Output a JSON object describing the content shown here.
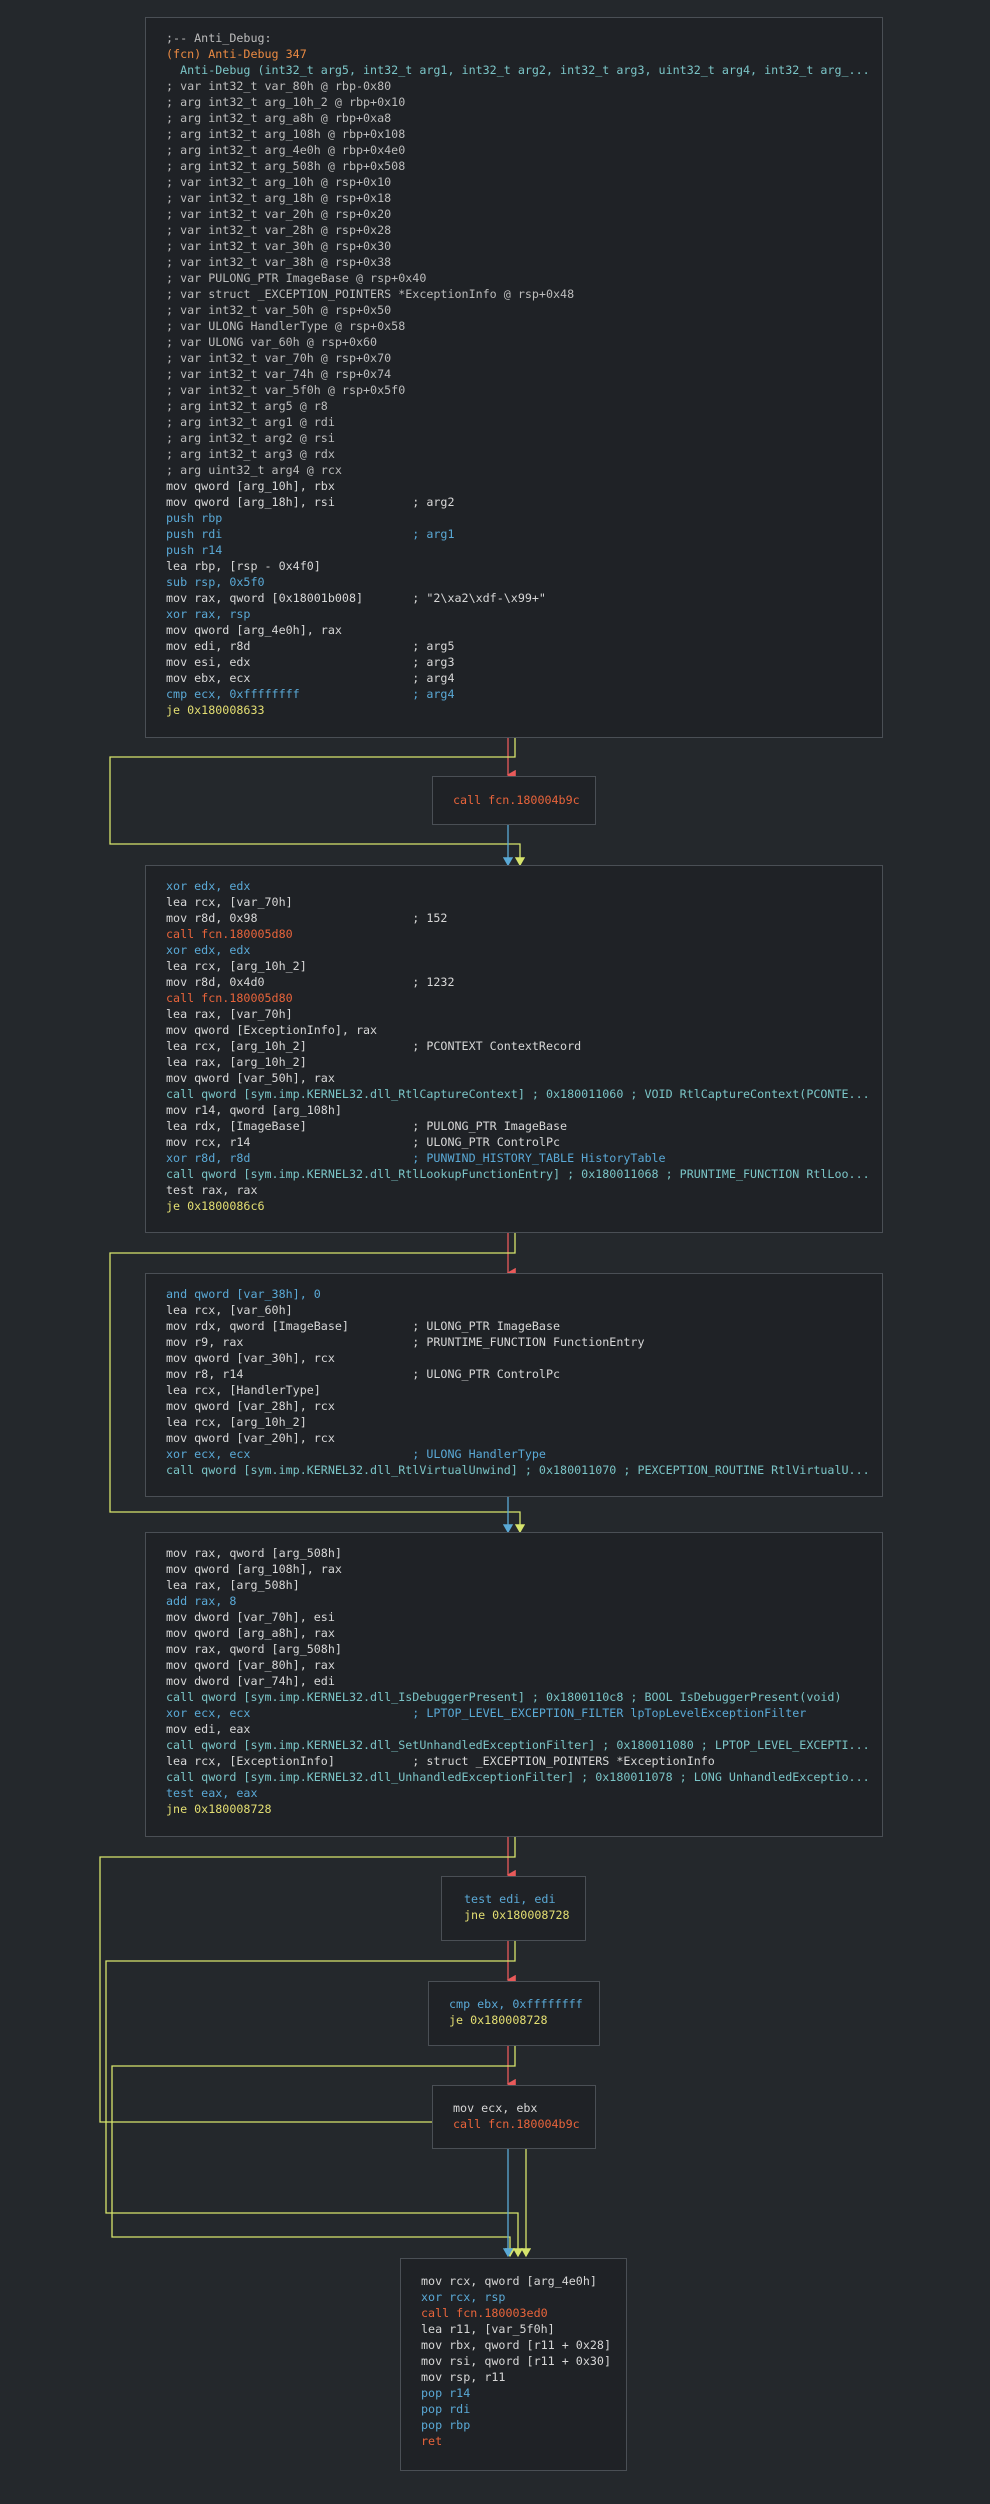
{
  "graph": {
    "function_name": "Anti_Debug",
    "colors": {
      "background": "#24282c",
      "node_background": "#1f2226",
      "node_border": "#4a4f55",
      "edge_true": "#d6e46c",
      "edge_false": "#e85a5a",
      "edge_unconditional": "#5aa9d6",
      "call_color": "#e8643b",
      "jump_color": "#e4df72",
      "flag_color": "#d07555",
      "symbol_color": "#7bc5c7"
    },
    "nodes": [
      {
        "id": "entry",
        "lines": [
          {
            "text": ";-- Anti_Debug:",
            "kind": "comment"
          },
          {
            "text": "(fcn) Anti-Debug 347",
            "kind": "fn"
          },
          {
            "text": "  Anti-Debug (int32_t arg5, int32_t arg1, int32_t arg2, int32_t arg3, uint32_t arg4, int32_t arg_...",
            "kind": "sym"
          },
          {
            "text": "; var int32_t var_80h @ rbp-0x80",
            "kind": "var"
          },
          {
            "text": "; arg int32_t arg_10h_2 @ rbp+0x10",
            "kind": "var"
          },
          {
            "text": "; arg int32_t arg_a8h @ rbp+0xa8",
            "kind": "var"
          },
          {
            "text": "; arg int32_t arg_108h @ rbp+0x108",
            "kind": "var"
          },
          {
            "text": "; arg int32_t arg_4e0h @ rbp+0x4e0",
            "kind": "var"
          },
          {
            "text": "; arg int32_t arg_508h @ rbp+0x508",
            "kind": "var"
          },
          {
            "text": "; var int32_t arg_10h @ rsp+0x10",
            "kind": "var"
          },
          {
            "text": "; var int32_t arg_18h @ rsp+0x18",
            "kind": "var"
          },
          {
            "text": "; var int32_t var_20h @ rsp+0x20",
            "kind": "var"
          },
          {
            "text": "; var int32_t var_28h @ rsp+0x28",
            "kind": "var"
          },
          {
            "text": "; var int32_t var_30h @ rsp+0x30",
            "kind": "var"
          },
          {
            "text": "; var int32_t var_38h @ rsp+0x38",
            "kind": "var"
          },
          {
            "text": "; var PULONG_PTR ImageBase @ rsp+0x40",
            "kind": "var"
          },
          {
            "text": "; var struct _EXCEPTION_POINTERS *ExceptionInfo @ rsp+0x48",
            "kind": "var"
          },
          {
            "text": "; var int32_t var_50h @ rsp+0x50",
            "kind": "var"
          },
          {
            "text": "; var ULONG HandlerType @ rsp+0x58",
            "kind": "var"
          },
          {
            "text": "; var ULONG var_60h @ rsp+0x60",
            "kind": "var"
          },
          {
            "text": "; var int32_t var_70h @ rsp+0x70",
            "kind": "var"
          },
          {
            "text": "; var int32_t var_74h @ rsp+0x74",
            "kind": "var"
          },
          {
            "text": "; var int32_t var_5f0h @ rsp+0x5f0",
            "kind": "var"
          },
          {
            "text": "; arg int32_t arg5 @ r8",
            "kind": "var"
          },
          {
            "text": "; arg int32_t arg1 @ rdi",
            "kind": "var"
          },
          {
            "text": "; arg int32_t arg2 @ rsi",
            "kind": "var"
          },
          {
            "text": "; arg int32_t arg3 @ rdx",
            "kind": "var"
          },
          {
            "text": "; arg uint32_t arg4 @ rcx",
            "kind": "var"
          },
          {
            "text": "mov qword [arg_10h], rbx",
            "kind": "mnem"
          },
          {
            "text": "mov qword [arg_18h], rsi           ; arg2",
            "kind": "mnem"
          },
          {
            "text": "push rbp",
            "kind": "nop"
          },
          {
            "text": "push rdi                           ; arg1",
            "kind": "nop"
          },
          {
            "text": "push r14",
            "kind": "nop"
          },
          {
            "text": "lea rbp, [rsp - 0x4f0]",
            "kind": "mnem"
          },
          {
            "text": "sub rsp, 0x5f0",
            "kind": "nop"
          },
          {
            "text": "mov rax, qword [0x18001b008]       ; \"2\\xa2\\xdf-\\x99+\"",
            "kind": "mnem"
          },
          {
            "text": "xor rax, rsp",
            "kind": "nop"
          },
          {
            "text": "mov qword [arg_4e0h], rax",
            "kind": "mnem"
          },
          {
            "text": "mov edi, r8d                       ; arg5",
            "kind": "mnem"
          },
          {
            "text": "mov esi, edx                       ; arg3",
            "kind": "mnem"
          },
          {
            "text": "mov ebx, ecx                       ; arg4",
            "kind": "mnem"
          },
          {
            "text": "cmp ecx, 0xffffffff                ; arg4",
            "kind": "nop"
          },
          {
            "text": "je 0x180008633",
            "kind": "jmp"
          }
        ]
      },
      {
        "id": "call_4b9c",
        "lines": [
          {
            "text": "call fcn.180004b9c",
            "kind": "call"
          }
        ]
      },
      {
        "id": "capture",
        "lines": [
          {
            "text": "xor edx, edx",
            "kind": "nop"
          },
          {
            "text": "lea rcx, [var_70h]",
            "kind": "mnem"
          },
          {
            "text": "mov r8d, 0x98                      ; 152",
            "kind": "mnem"
          },
          {
            "text": "call fcn.180005d80",
            "kind": "call"
          },
          {
            "text": "xor edx, edx",
            "kind": "nop"
          },
          {
            "text": "lea rcx, [arg_10h_2]",
            "kind": "mnem"
          },
          {
            "text": "mov r8d, 0x4d0                     ; 1232",
            "kind": "mnem"
          },
          {
            "text": "call fcn.180005d80",
            "kind": "call"
          },
          {
            "text": "lea rax, [var_70h]",
            "kind": "mnem"
          },
          {
            "text": "mov qword [ExceptionInfo], rax",
            "kind": "mnem"
          },
          {
            "text": "lea rcx, [arg_10h_2]               ; PCONTEXT ContextRecord",
            "kind": "mnem"
          },
          {
            "text": "lea rax, [arg_10h_2]",
            "kind": "mnem"
          },
          {
            "text": "mov qword [var_50h], rax",
            "kind": "mnem"
          },
          {
            "text": "call qword [sym.imp.KERNEL32.dll_RtlCaptureContext] ; 0x180011060 ; VOID RtlCaptureContext(PCONTE...",
            "kind": "sym"
          },
          {
            "text": "mov r14, qword [arg_108h]",
            "kind": "mnem"
          },
          {
            "text": "lea rdx, [ImageBase]               ; PULONG_PTR ImageBase",
            "kind": "mnem"
          },
          {
            "text": "mov rcx, r14                       ; ULONG_PTR ControlPc",
            "kind": "mnem"
          },
          {
            "text": "xor r8d, r8d                       ; PUNWIND_HISTORY_TABLE HistoryTable",
            "kind": "nop"
          },
          {
            "text": "call qword [sym.imp.KERNEL32.dll_RtlLookupFunctionEntry] ; 0x180011068 ; PRUNTIME_FUNCTION RtlLoo...",
            "kind": "sym"
          },
          {
            "text": "test rax, rax",
            "kind": "mnem"
          },
          {
            "text": "je 0x1800086c6",
            "kind": "jmp"
          }
        ]
      },
      {
        "id": "unwind",
        "lines": [
          {
            "text": "and qword [var_38h], 0",
            "kind": "nop"
          },
          {
            "text": "lea rcx, [var_60h]",
            "kind": "mnem"
          },
          {
            "text": "mov rdx, qword [ImageBase]         ; ULONG_PTR ImageBase",
            "kind": "mnem"
          },
          {
            "text": "mov r9, rax                        ; PRUNTIME_FUNCTION FunctionEntry",
            "kind": "mnem"
          },
          {
            "text": "mov qword [var_30h], rcx",
            "kind": "mnem"
          },
          {
            "text": "mov r8, r14                        ; ULONG_PTR ControlPc",
            "kind": "mnem"
          },
          {
            "text": "lea rcx, [HandlerType]",
            "kind": "mnem"
          },
          {
            "text": "mov qword [var_28h], rcx",
            "kind": "mnem"
          },
          {
            "text": "lea rcx, [arg_10h_2]",
            "kind": "mnem"
          },
          {
            "text": "mov qword [var_20h], rcx",
            "kind": "mnem"
          },
          {
            "text": "xor ecx, ecx                       ; ULONG HandlerType",
            "kind": "nop"
          },
          {
            "text": "call qword [sym.imp.KERNEL32.dll_RtlVirtualUnwind] ; 0x180011070 ; PEXCEPTION_ROUTINE RtlVirtualU...",
            "kind": "sym"
          }
        ]
      },
      {
        "id": "debugger_check",
        "lines": [
          {
            "text": "mov rax, qword [arg_508h]",
            "kind": "mnem"
          },
          {
            "text": "mov qword [arg_108h], rax",
            "kind": "mnem"
          },
          {
            "text": "lea rax, [arg_508h]",
            "kind": "mnem"
          },
          {
            "text": "add rax, 8",
            "kind": "nop"
          },
          {
            "text": "mov dword [var_70h], esi",
            "kind": "mnem"
          },
          {
            "text": "mov qword [arg_a8h], rax",
            "kind": "mnem"
          },
          {
            "text": "mov rax, qword [arg_508h]",
            "kind": "mnem"
          },
          {
            "text": "mov qword [var_80h], rax",
            "kind": "mnem"
          },
          {
            "text": "mov dword [var_74h], edi",
            "kind": "mnem"
          },
          {
            "text": "call qword [sym.imp.KERNEL32.dll_IsDebuggerPresent] ; 0x1800110c8 ; BOOL IsDebuggerPresent(void)",
            "kind": "sym"
          },
          {
            "text": "xor ecx, ecx                       ; LPTOP_LEVEL_EXCEPTION_FILTER lpTopLevelExceptionFilter",
            "kind": "nop"
          },
          {
            "text": "mov edi, eax",
            "kind": "mnem"
          },
          {
            "text": "call qword [sym.imp.KERNEL32.dll_SetUnhandledExceptionFilter] ; 0x180011080 ; LPTOP_LEVEL_EXCEPTI...",
            "kind": "sym"
          },
          {
            "text": "lea rcx, [ExceptionInfo]           ; struct _EXCEPTION_POINTERS *ExceptionInfo",
            "kind": "mnem"
          },
          {
            "text": "call qword [sym.imp.KERNEL32.dll_UnhandledExceptionFilter] ; 0x180011078 ; LONG UnhandledExceptio...",
            "kind": "sym"
          },
          {
            "text": "test eax, eax",
            "kind": "nop"
          },
          {
            "text": "jne 0x180008728",
            "kind": "jmp"
          }
        ]
      },
      {
        "id": "test_edi",
        "lines": [
          {
            "text": "test edi, edi",
            "kind": "nop"
          },
          {
            "text": "jne 0x180008728",
            "kind": "jmp"
          }
        ]
      },
      {
        "id": "cmp_ebx",
        "lines": [
          {
            "text": "cmp ebx, 0xffffffff",
            "kind": "nop"
          },
          {
            "text": "je 0x180008728",
            "kind": "jmp"
          }
        ]
      },
      {
        "id": "call_again",
        "lines": [
          {
            "text": "mov ecx, ebx",
            "kind": "mnem"
          },
          {
            "text": "call fcn.180004b9c",
            "kind": "call"
          }
        ]
      },
      {
        "id": "epilogue",
        "lines": [
          {
            "text": "mov rcx, qword [arg_4e0h]",
            "kind": "mnem"
          },
          {
            "text": "xor rcx, rsp",
            "kind": "nop"
          },
          {
            "text": "call fcn.180003ed0",
            "kind": "call"
          },
          {
            "text": "lea r11, [var_5f0h]",
            "kind": "mnem"
          },
          {
            "text": "mov rbx, qword [r11 + 0x28]",
            "kind": "mnem"
          },
          {
            "text": "mov rsi, qword [r11 + 0x30]",
            "kind": "mnem"
          },
          {
            "text": "mov rsp, r11",
            "kind": "mnem"
          },
          {
            "text": "pop r14",
            "kind": "nop"
          },
          {
            "text": "pop rdi",
            "kind": "nop"
          },
          {
            "text": "pop rbp",
            "kind": "nop"
          },
          {
            "text": "ret",
            "kind": "ret"
          }
        ]
      }
    ]
  }
}
